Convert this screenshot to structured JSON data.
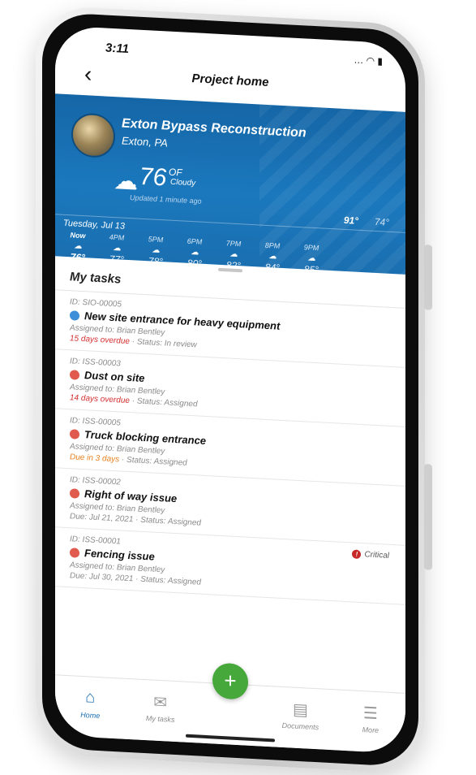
{
  "status_bar": {
    "time": "3:11",
    "icons": "… ◠ ▮"
  },
  "header": {
    "back_icon": "chevron-left-icon",
    "title": "Project home"
  },
  "project": {
    "name": "Exton Bypass Reconstruction",
    "location": "Exton, PA"
  },
  "weather": {
    "icon": "cloud-icon",
    "temperature": "76",
    "unit": "OF",
    "condition": "Cloudy",
    "updated": "Updated 1 minute ago",
    "high": "91°",
    "low": "74°",
    "date": "Tuesday, Jul 13",
    "hourly": [
      {
        "label": "Now",
        "temp": "76°"
      },
      {
        "label": "4PM",
        "temp": "77°"
      },
      {
        "label": "5PM",
        "temp": "78°"
      },
      {
        "label": "6PM",
        "temp": "80°"
      },
      {
        "label": "7PM",
        "temp": "82°"
      },
      {
        "label": "8PM",
        "temp": "84°"
      },
      {
        "label": "9PM",
        "temp": "85°"
      }
    ]
  },
  "tasks_section": {
    "title": "My tasks"
  },
  "tasks": [
    {
      "id": "ID: SIO-00005",
      "type": "sio",
      "title": "New site entrance for heavy equipment",
      "assigned": "Assigned to: Brian Bentley",
      "due": "15 days overdue",
      "status": " · Status: In review"
    },
    {
      "id": "ID: ISS-00003",
      "type": "iss",
      "title": "Dust on site",
      "assigned": "Assigned to: Brian Bentley",
      "due": "14 days overdue",
      "status": " · Status: Assigned"
    },
    {
      "id": "ID: ISS-00005",
      "type": "iss",
      "title": "Truck blocking entrance",
      "assigned": "Assigned to: Brian Bentley",
      "due": "Due in 3 days",
      "status": " · Status: Assigned"
    },
    {
      "id": "ID: ISS-00002",
      "type": "iss",
      "title": "Right of way issue",
      "assigned": "Assigned to: Brian Bentley",
      "due": "Due: Jul 21, 2021",
      "status": " · Status: Assigned"
    },
    {
      "id": "ID: ISS-00001",
      "type": "iss",
      "title": "Fencing issue",
      "assigned": "Assigned to: Brian Bentley",
      "due": "Due: Jul 30, 2021",
      "status": " · Status: Assigned",
      "badge": "Critical"
    }
  ],
  "bottom_nav": {
    "home": "Home",
    "my_tasks": "My tasks",
    "add": "+",
    "documents": "Documents",
    "more": "More"
  },
  "colors": {
    "brand_blue": "#1b78bd",
    "overdue_red": "#d22f2f",
    "due_orange": "#e6801f",
    "fab_green": "#46a83a"
  }
}
